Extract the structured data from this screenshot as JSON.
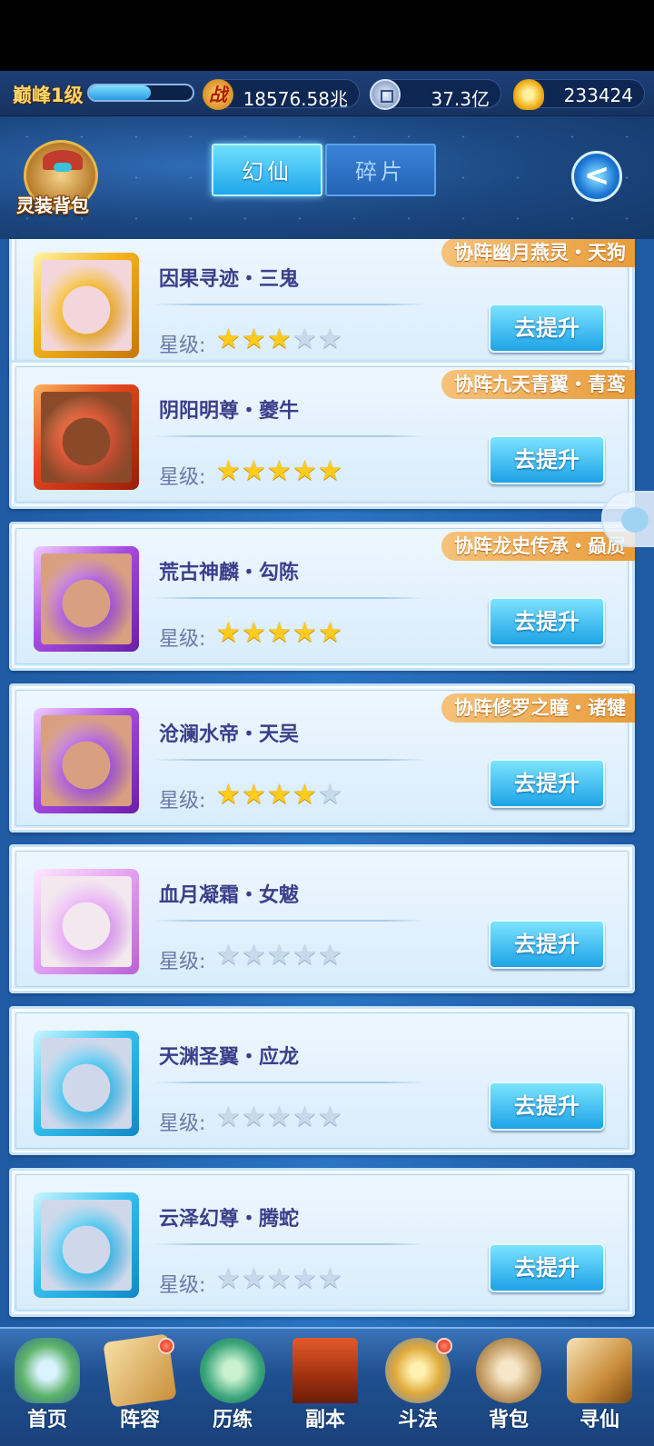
{
  "top_bar": {
    "level": "巅峰1级",
    "exp_fraction": 0.6,
    "power_icon_glyph": "战",
    "power": "18576.58兆",
    "coins": "37.3亿",
    "gold": "233424"
  },
  "header": {
    "bag_label": "灵装背包",
    "tabs": [
      {
        "label": "幻仙",
        "active": true
      },
      {
        "label": "碎片",
        "active": false
      }
    ],
    "back_glyph": "<"
  },
  "list": {
    "star_label": "星级:",
    "button_label": "去提升",
    "items": [
      {
        "name": "因果寻迹・三鬼",
        "bond": "协阵幽月燕灵・天狗",
        "stars": 3,
        "frame": "gold"
      },
      {
        "name": "阴阳明尊・夔牛",
        "bond": "协阵九天青翼・青鸾",
        "stars": 5,
        "frame": "red"
      },
      {
        "name": "荒古神麟・勾陈",
        "bond": "协阵龙史传承・赑屃",
        "stars": 5,
        "frame": "purple"
      },
      {
        "name": "沧澜水帝・天吴",
        "bond": "协阵修罗之瞳・诸犍",
        "stars": 4,
        "frame": "purple"
      },
      {
        "name": "血月凝霜・女魃",
        "bond": "",
        "stars": 0,
        "frame": "pink"
      },
      {
        "name": "天渊圣翼・应龙",
        "bond": "",
        "stars": 0,
        "frame": "blue"
      },
      {
        "name": "云泽幻尊・腾蛇",
        "bond": "",
        "stars": 0,
        "frame": "blue"
      }
    ]
  },
  "nav": {
    "items": [
      {
        "label": "首页",
        "icon": "home-icon",
        "badge": false
      },
      {
        "label": "阵容",
        "icon": "team-icon",
        "badge": true
      },
      {
        "label": "历练",
        "icon": "train-icon",
        "badge": false
      },
      {
        "label": "副本",
        "icon": "dungeon-icon",
        "badge": false
      },
      {
        "label": "斗法",
        "icon": "fight-icon",
        "badge": true
      },
      {
        "label": "背包",
        "icon": "bag-icon",
        "badge": false
      },
      {
        "label": "寻仙",
        "icon": "seek-icon",
        "badge": false
      }
    ]
  }
}
